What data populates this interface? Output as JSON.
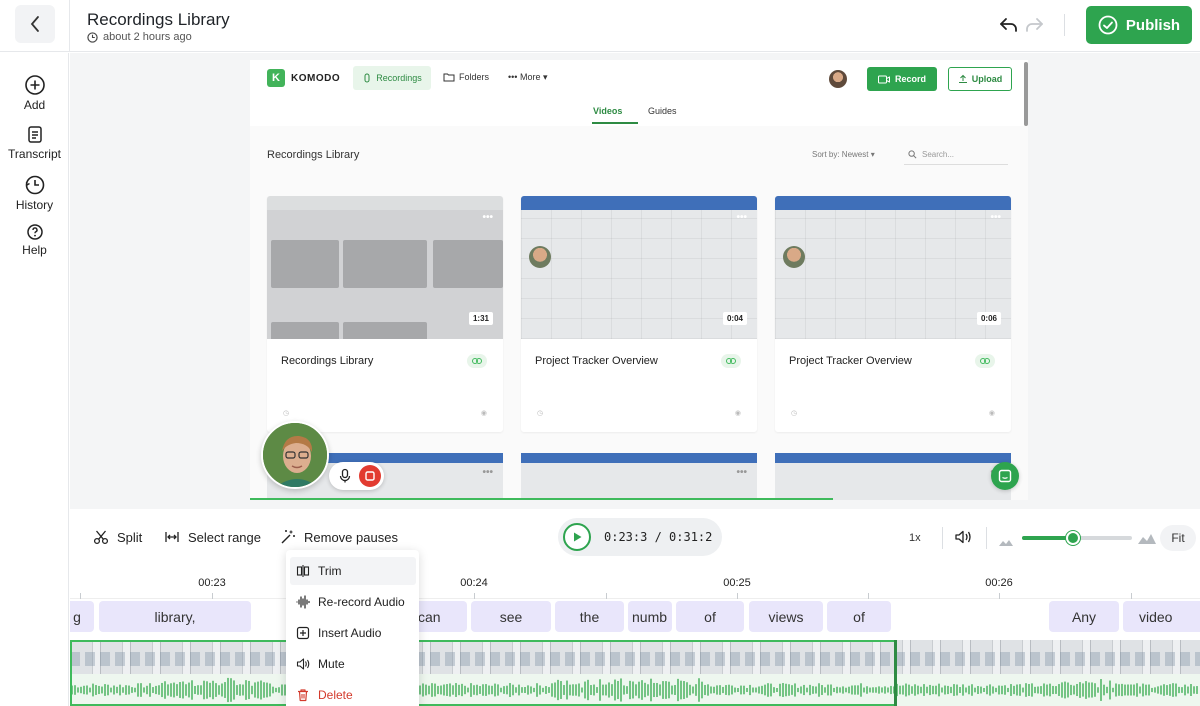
{
  "header": {
    "title": "Recordings Library",
    "timestamp": "about 2 hours ago",
    "publish_label": "Publish"
  },
  "sidebar": {
    "items": [
      {
        "label": "Add",
        "icon": "plus-circle-icon"
      },
      {
        "label": "Transcript",
        "icon": "document-icon"
      },
      {
        "label": "History",
        "icon": "history-icon"
      },
      {
        "label": "Help",
        "icon": "question-circle-icon"
      }
    ]
  },
  "recording": {
    "nav": {
      "logo_letter": "K",
      "brand": "KOMODO",
      "tab_recordings": "Recordings",
      "tab_folders": "Folders",
      "tab_more": "More",
      "record_label": "Record",
      "upload_label": "Upload"
    },
    "tabs": {
      "videos": "Videos",
      "guides": "Guides"
    },
    "library_title": "Recordings Library",
    "sort_label": "Sort by: Newest",
    "search_placeholder": "Search...",
    "cards": [
      {
        "title": "Recordings Library",
        "duration": "1:31"
      },
      {
        "title": "Project Tracker Overview",
        "duration": "0:04"
      },
      {
        "title": "Project Tracker Overview",
        "duration": "0:06"
      }
    ]
  },
  "toolbar": {
    "split_label": "Split",
    "select_range_label": "Select range",
    "remove_pauses_label": "Remove pauses",
    "timecode": "0:23:3 / 0:31:2",
    "speed": "1x",
    "fit_label": "Fit",
    "zoom_level": 0.46
  },
  "timeline": {
    "ticks": [
      "00:23",
      "00:24",
      "00:25",
      "00:26"
    ],
    "words": [
      "g",
      "library,",
      "can",
      "see",
      "the",
      "numb",
      "of",
      "views",
      "of",
      "Any",
      "video"
    ]
  },
  "context_menu": {
    "items": [
      {
        "label": "Trim",
        "icon": "trim-icon"
      },
      {
        "label": "Re-record Audio",
        "icon": "waveform-icon"
      },
      {
        "label": "Insert Audio",
        "icon": "plus-square-icon"
      },
      {
        "label": "Mute",
        "icon": "speaker-icon"
      },
      {
        "label": "Delete",
        "icon": "trash-icon"
      }
    ]
  },
  "colors": {
    "accent": "#2ea44f",
    "danger": "#d33a2c",
    "word_chip": "#e9e6fb"
  }
}
